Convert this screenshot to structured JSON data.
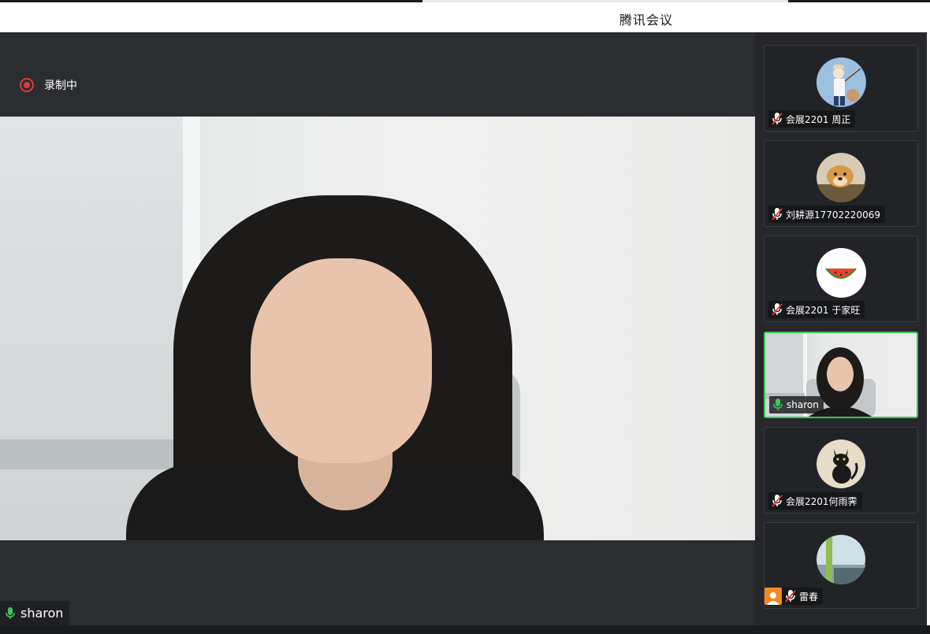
{
  "window": {
    "title": "腾讯会议"
  },
  "recording": {
    "label": "录制中",
    "color": "#e03a3a"
  },
  "main_video": {
    "speaker_name": "sharon",
    "mic_state": "on",
    "mic_color": "#3ec45b"
  },
  "participants": [
    {
      "label": "会展2201 周正",
      "mic_state": "muted",
      "avatar_icon": "anime-fisherman-avatar",
      "active": false
    },
    {
      "label": "刘耕源17702220069",
      "mic_state": "muted",
      "avatar_icon": "doge-dog-avatar",
      "active": false
    },
    {
      "label": "会展2201 于家旺",
      "mic_state": "muted",
      "avatar_icon": "watermelon-avatar",
      "active": false
    },
    {
      "label": "sharon",
      "mic_state": "on",
      "avatar_icon": "video-thumbnail",
      "active": true
    },
    {
      "label": "会展2201何雨霁",
      "mic_state": "muted",
      "avatar_icon": "black-cat-avatar",
      "active": false
    },
    {
      "label": "雷春",
      "mic_state": "muted",
      "avatar_icon": "landscape-avatar",
      "active": false,
      "host": true
    }
  ]
}
